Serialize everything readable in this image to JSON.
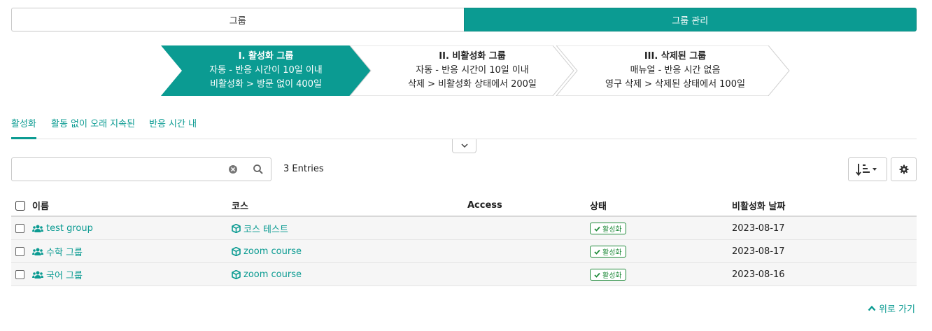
{
  "segments": {
    "groups_label": "그룹",
    "manage_label": "그룹 관리"
  },
  "steps": [
    {
      "title": "I. 활성화 그룹",
      "line1": "자동 - 반응 시간이 10일 이내",
      "line2": "비활성화 > 방문 없이 400일"
    },
    {
      "title": "II. 비활성화 그룹",
      "line1": "자동 - 반응 시간이 10일 이내",
      "line2": "삭제 > 비활성화 상태에서 200일"
    },
    {
      "title": "III. 삭제된 그룹",
      "line1": "매뉴얼 - 반응 시간 없음",
      "line2": "영구 삭제 > 삭제된 상태에서 100일"
    }
  ],
  "tabs": [
    "활성화",
    "활동 없이 오래 지속된",
    "반응 시간 내"
  ],
  "search": {
    "value": "",
    "placeholder": ""
  },
  "entries_label": "3 Entries",
  "table": {
    "headers": {
      "name": "이름",
      "course": "코스",
      "access": "Access",
      "status": "상태",
      "date": "비활성화 날짜"
    },
    "rows": [
      {
        "name": "test group",
        "course": "코스 테스트",
        "access": "",
        "status": "활성화",
        "date": "2023-08-17"
      },
      {
        "name": "수학 그룹",
        "course": "zoom course",
        "access": "",
        "status": "활성화",
        "date": "2023-08-17"
      },
      {
        "name": "국어 그룹",
        "course": "zoom course",
        "access": "",
        "status": "활성화",
        "date": "2023-08-16"
      }
    ]
  },
  "back_to_top": "위로 가기",
  "colors": {
    "accent": "#0b9b92",
    "status_green": "#1f8a3a"
  },
  "icons": [
    "users-icon",
    "cube-icon",
    "check-icon",
    "search-icon",
    "clear-icon",
    "sort-icon",
    "gear-icon",
    "chevron-down-icon",
    "chevron-up-icon"
  ]
}
